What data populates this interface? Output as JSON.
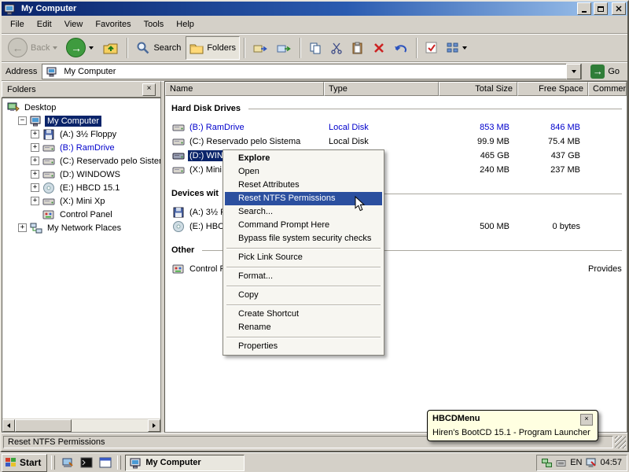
{
  "window": {
    "title": "My Computer"
  },
  "menu_bar": {
    "items": [
      "File",
      "Edit",
      "View",
      "Favorites",
      "Tools",
      "Help"
    ]
  },
  "toolbar": {
    "back_label": "Back",
    "search_label": "Search",
    "folders_label": "Folders"
  },
  "address_bar": {
    "label": "Address",
    "value": "My Computer",
    "go_label": "Go"
  },
  "folders_pane": {
    "title": "Folders",
    "close_glyph": "×",
    "items": [
      {
        "label": "Desktop"
      },
      {
        "label": "My Computer"
      },
      {
        "label": "(A:) 3½ Floppy"
      },
      {
        "label": "(B:) RamDrive"
      },
      {
        "label": "(C:) Reservado pelo Sistema"
      },
      {
        "label": "(D:) WINDOWS"
      },
      {
        "label": "(E:) HBCD 15.1"
      },
      {
        "label": "(X:) Mini Xp"
      },
      {
        "label": "Control Panel"
      },
      {
        "label": "My Network Places"
      }
    ]
  },
  "file_list": {
    "columns": [
      "Name",
      "Type",
      "Total Size",
      "Free Space",
      "Comment"
    ],
    "groups": [
      "Hard Disk Drives",
      "Devices wit",
      "Other"
    ],
    "rows": [
      {
        "name": "(B:) RamDrive",
        "type": "Local Disk",
        "total_size": "853 MB",
        "free_space": "846 MB"
      },
      {
        "name": "(C:) Reservado pelo Sistema",
        "type": "Local Disk",
        "total_size": "99.9 MB",
        "free_space": "75.4 MB"
      },
      {
        "name": "(D:) WINDOW",
        "total_size": "465 GB",
        "free_space": "437 GB"
      },
      {
        "name": "(X:) Mini Xp",
        "total_size": "240 MB",
        "free_space": "237 MB"
      },
      {
        "name": "(A:) 3½ Flop"
      },
      {
        "name": "(E:) HBCD 1",
        "total_size": "500 MB",
        "free_space": "0 bytes"
      },
      {
        "name": "Control Pan",
        "comment": "Provides"
      }
    ]
  },
  "context_menu": {
    "items": [
      "Explore",
      "Open",
      "Reset Attributes",
      "Reset NTFS Permissions",
      "Search...",
      "Command Prompt Here",
      "Bypass file system security checks",
      "Pick Link Source",
      "Format...",
      "Copy",
      "Create Shortcut",
      "Rename",
      "Properties"
    ]
  },
  "balloon": {
    "title": "HBCDMenu",
    "text": "Hiren's BootCD 15.1 - Program Launcher",
    "close_glyph": "×"
  },
  "status_bar": {
    "text": "Reset NTFS Permissions"
  },
  "taskbar": {
    "start_label": "Start",
    "task_button": "My Computer",
    "language": "EN",
    "clock": "04:57"
  },
  "icons": {
    "expander_expanded": "−",
    "expander_collapsed": "+",
    "back_arrow": "←",
    "forward_arrow": "→",
    "go_arrow": "→"
  },
  "colors": {
    "title_gradient_start": "#0a246a",
    "title_gradient_end": "#a6caf0",
    "selection": "#0a246a",
    "menu_highlight": "#2b4f9f",
    "link_blue": "#0000cc",
    "balloon_bg": "#ffffe1"
  }
}
